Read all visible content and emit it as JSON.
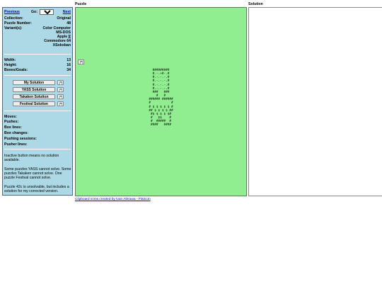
{
  "nav": {
    "previous": "Previous",
    "go_label": "Go:",
    "go_value": "48",
    "next": "Next"
  },
  "info": {
    "collection_label": "Collection:",
    "collection_value": "Original",
    "puzzle_number_label": "Puzzle Number:",
    "puzzle_number_value": "48",
    "variants_label": "Variant(s):",
    "variants": [
      "Color Computer",
      "MS-DOS",
      "Apple ][",
      "Commodore 64",
      "XSokoban"
    ]
  },
  "dims": {
    "width_label": "Width:",
    "width_value": "13",
    "height_label": "Height:",
    "height_value": "16",
    "boxes_label": "Boxes/Goals:",
    "boxes_value": "34"
  },
  "solution_buttons": [
    "My Solution",
    "YASS Solution",
    "Takaken Solution",
    "Festival Solution"
  ],
  "stats": [
    "Moves:",
    "Pushes:",
    "Box lines:",
    "Box changes:",
    "Pushing sessions:",
    "Pusher lines:"
  ],
  "notes": [
    "Inactive button means no solution available.",
    "Some puzzles YASS cannot solve. Some puzzles Takaken cannot solve. One puzzle Festival cannot solve.",
    "Puzzle 42c is unsolvable, but includes a solution for my corrected version."
  ],
  "panels": {
    "puzzle_title": "Puzzle",
    "solution_title": "Solution"
  },
  "puzzle_grid": [
    "#########",
    "#.-.+#-.#",
    "#.-.-.-.#",
    "#.-.-.-.#",
    "#.-.-.-.#",
    "#.-.-.-.#",
    "###   ###",
    "  #   #  ",
    "###### ######",
    "#           #",
    "# $ $ $ $ $ #",
    "## $ $ $ $ ##",
    " #$ $ $ $ $# ",
    " #   $$    # ",
    " #  #####  # ",
    " ####   #### "
  ],
  "credit": "Clipboard icons created by Ivan Abirawa - Flaticon",
  "colors": {
    "sidebar_bg": "#add8e6",
    "puzzle_bg": "#90ee90",
    "link": "#0000cc"
  }
}
